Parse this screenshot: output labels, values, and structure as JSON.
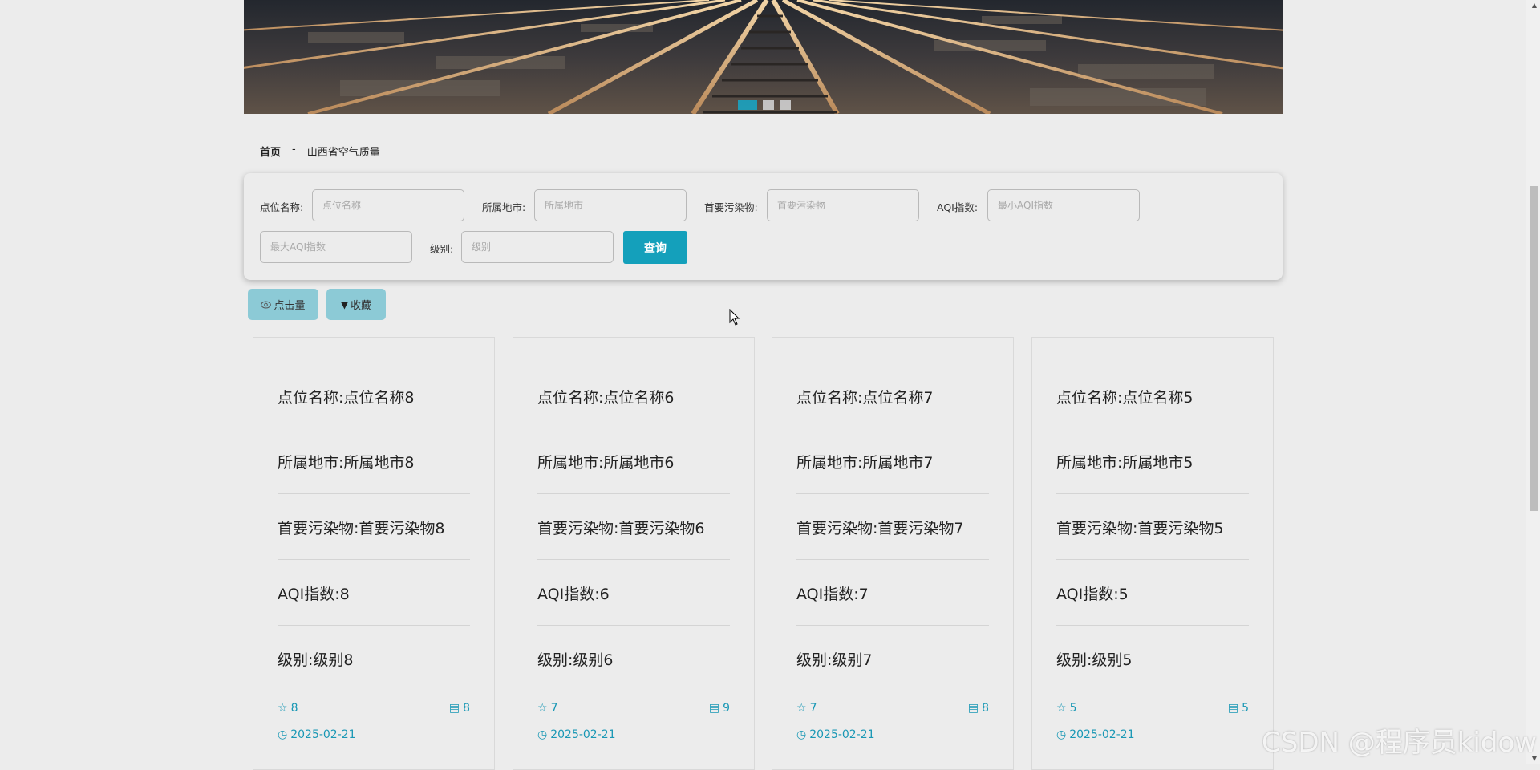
{
  "banner": {
    "dots_count": 3,
    "active_dot": 0
  },
  "breadcrumb": {
    "home": "首页",
    "separator": "-",
    "current": "山西省空气质量"
  },
  "search": {
    "fields": [
      {
        "label": "点位名称:",
        "placeholder": "点位名称",
        "value": ""
      },
      {
        "label": "所属地市:",
        "placeholder": "所属地市",
        "value": ""
      },
      {
        "label": "首要污染物:",
        "placeholder": "首要污染物",
        "value": ""
      },
      {
        "label": "AQI指数:",
        "placeholder": "最小AQI指数",
        "value": ""
      },
      {
        "label": "",
        "placeholder": "最大AQI指数",
        "value": ""
      },
      {
        "label": "级别:",
        "placeholder": "级别",
        "value": ""
      }
    ],
    "query_label": "查询"
  },
  "sort_buttons": {
    "clicks_label": "点击量",
    "favorites_label": "收藏"
  },
  "cards": [
    {
      "name": "点位名称:点位名称8",
      "city": "所属地市:所属地市8",
      "pollutant": "首要污染物:首要污染物8",
      "aqi": "AQI指数:8",
      "level": "级别:级别8",
      "favorites": "8",
      "comments": "8",
      "date": "2025-02-21"
    },
    {
      "name": "点位名称:点位名称6",
      "city": "所属地市:所属地市6",
      "pollutant": "首要污染物:首要污染物6",
      "aqi": "AQI指数:6",
      "level": "级别:级别6",
      "favorites": "7",
      "comments": "9",
      "date": "2025-02-21"
    },
    {
      "name": "点位名称:点位名称7",
      "city": "所属地市:所属地市7",
      "pollutant": "首要污染物:首要污染物7",
      "aqi": "AQI指数:7",
      "level": "级别:级别7",
      "favorites": "7",
      "comments": "8",
      "date": "2025-02-21"
    },
    {
      "name": "点位名称:点位名称5",
      "city": "所属地市:所属地市5",
      "pollutant": "首要污染物:首要污染物5",
      "aqi": "AQI指数:5",
      "level": "级别:级别5",
      "favorites": "5",
      "comments": "5",
      "date": "2025-02-21"
    }
  ],
  "watermark": "CSDN @程序员kidow",
  "colors": {
    "accent": "#14a0bb",
    "sort_button_bg": "#8ccad6",
    "meta_text": "#1a98b5"
  }
}
